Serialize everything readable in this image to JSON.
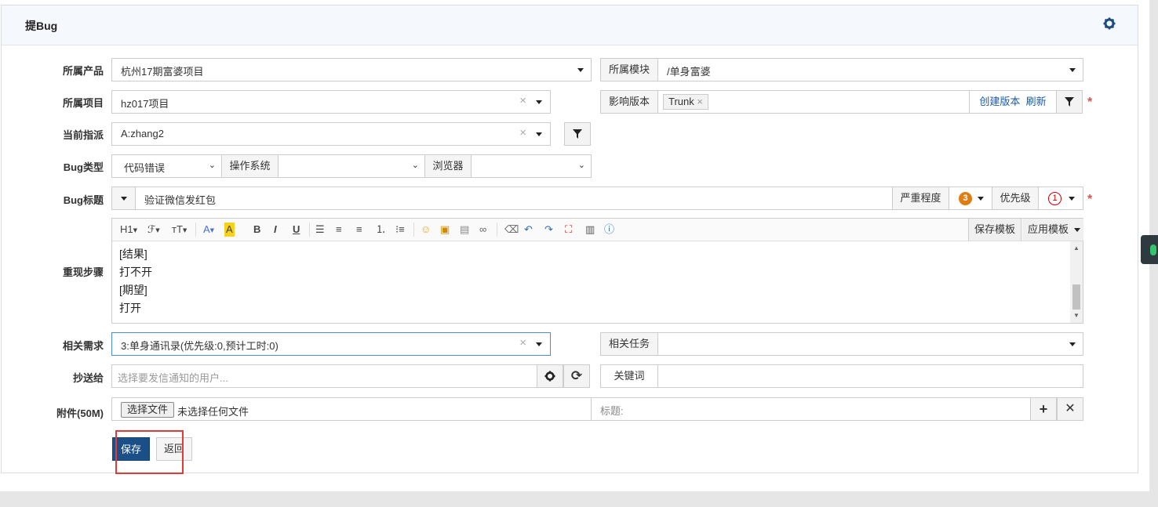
{
  "panel": {
    "title": "提Bug"
  },
  "fields": {
    "product_label": "所属产品",
    "product_value": "杭州17期富婆项目",
    "module_label": "所属模块",
    "module_value": "/单身富婆",
    "project_label": "所属项目",
    "project_value": "hz017项目",
    "version_label": "影响版本",
    "version_tag": "Trunk",
    "create_version": "创建版本",
    "refresh": "刷新",
    "assign_label": "当前指派",
    "assign_value": "A:zhang2",
    "type_label": "Bug类型",
    "type_value": "代码错误",
    "os_label": "操作系统",
    "os_value": "",
    "browser_label": "浏览器",
    "browser_value": "",
    "title_label": "Bug标题",
    "title_value": "验证微信发红包",
    "severity_label": "严重程度",
    "severity_value": "3",
    "priority_label": "优先级",
    "priority_value": "1",
    "steps_label": "重现步骤",
    "steps_lines": [
      "[结果]",
      "打不开",
      "[期望]",
      "打开"
    ],
    "save_template": "保存模板",
    "apply_template": "应用模板",
    "story_label": "相关需求",
    "story_value": "3:单身通讯录(优先级:0,预计工时:0)",
    "task_label": "相关任务",
    "task_value": "",
    "cc_label": "抄送给",
    "cc_placeholder": "选择要发信通知的用户...",
    "keywords_label": "关键词",
    "keywords_value": "",
    "attach_label": "附件(50M)",
    "choose_file": "选择文件",
    "no_file": "未选择任何文件",
    "attach_title_placeholder": "标题:"
  },
  "toolbar_icons": [
    "H1",
    "font-icon",
    "text-size-icon",
    "font-color-icon",
    "highlight-icon",
    "B",
    "I",
    "U",
    "align-left-icon",
    "align-center-icon",
    "align-right-icon",
    "ordered-list-icon",
    "unordered-list-icon",
    "emoji-icon",
    "image-icon",
    "media-icon",
    "link-icon",
    "eraser-icon",
    "undo-icon",
    "redo-icon",
    "fullscreen-icon",
    "paste-icon",
    "help-icon"
  ],
  "actions": {
    "save": "保存",
    "back": "返回"
  },
  "colors": {
    "primary": "#1b4f87",
    "link": "#1e5aa8",
    "required": "#d9534f",
    "severity": "#e07d10",
    "priority": "#cc0000"
  }
}
